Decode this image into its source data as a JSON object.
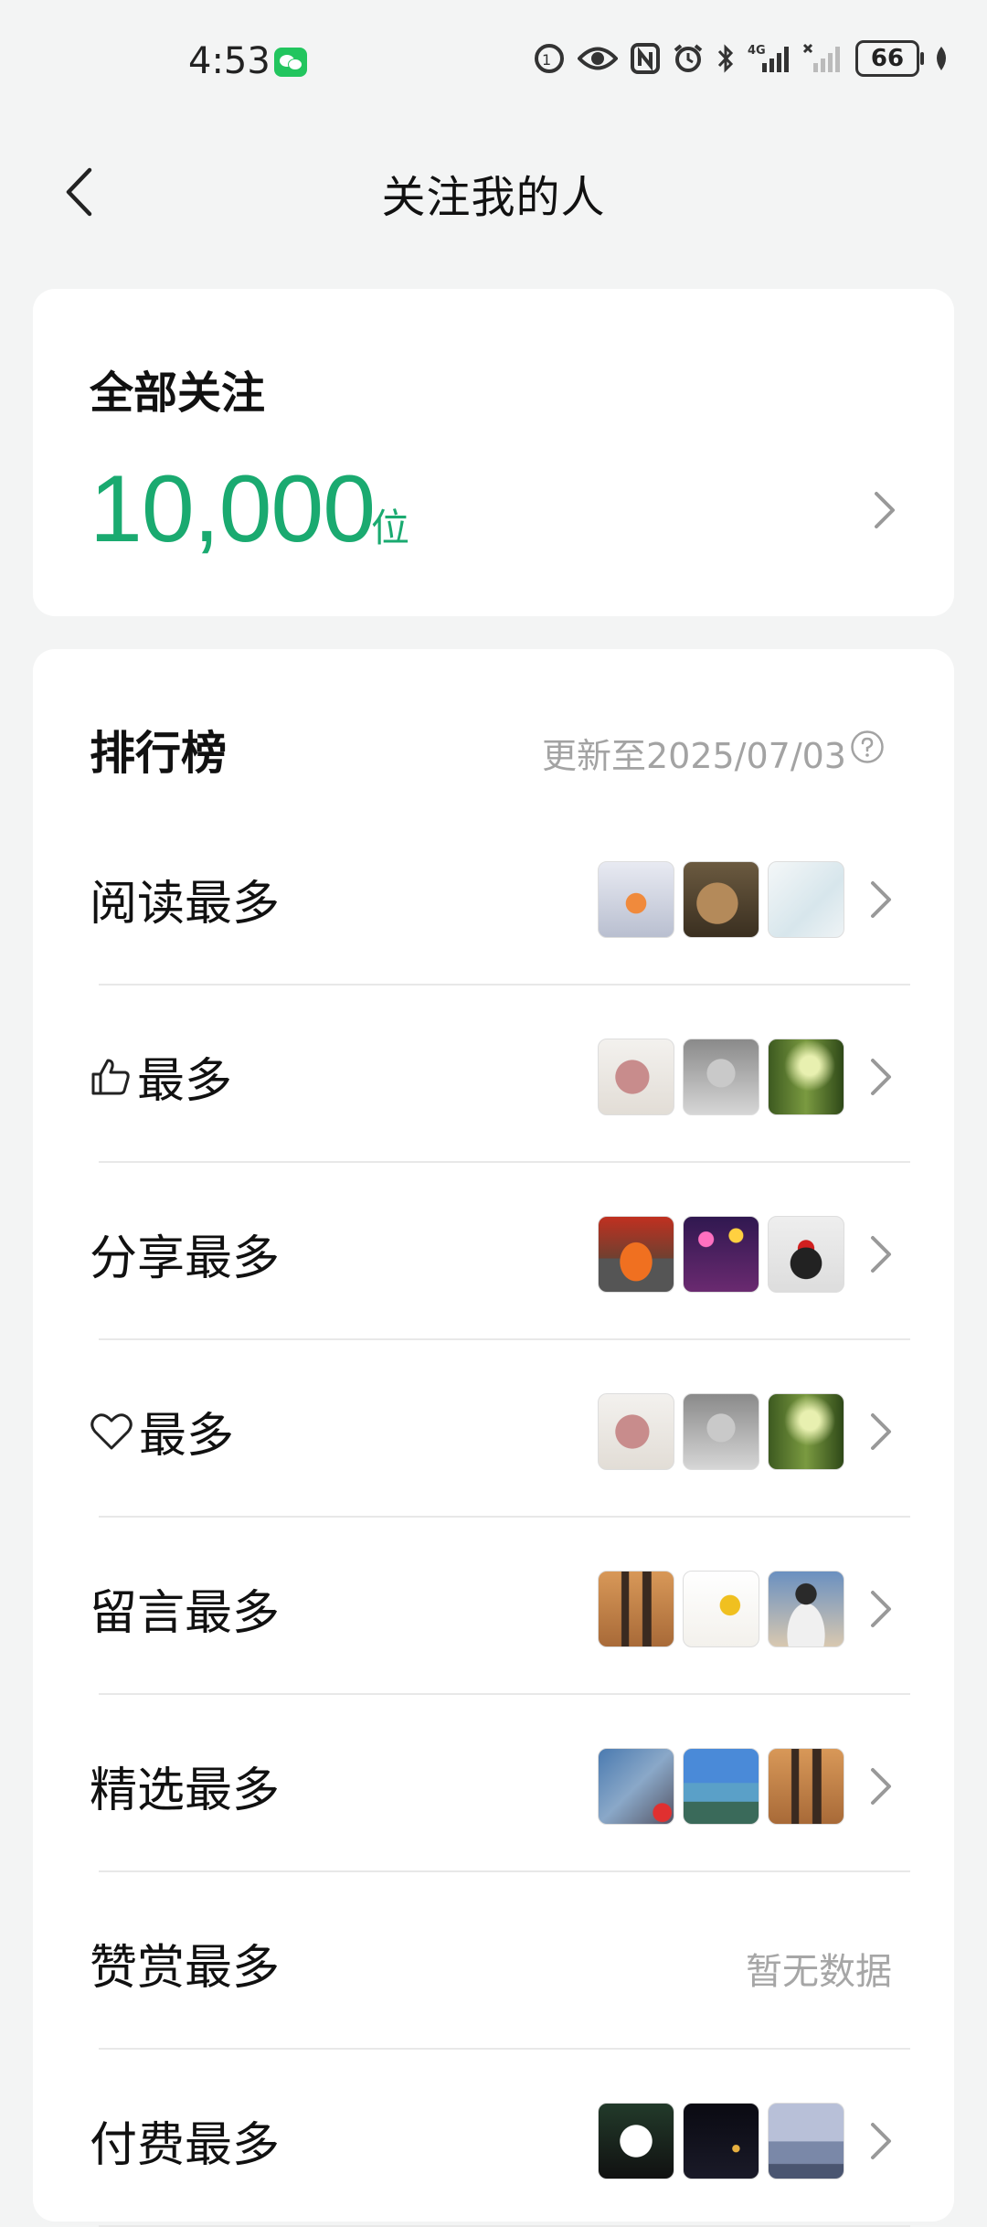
{
  "status_bar": {
    "time": "4:53",
    "battery": "66",
    "icons": [
      "wechat-notification-icon",
      "hd-voice-icon",
      "eye-icon",
      "nfc-icon",
      "alarm-icon",
      "bluetooth-icon",
      "signal-4g-icon",
      "signal-no-service-icon",
      "battery-icon",
      "leaf-icon"
    ]
  },
  "nav": {
    "title": "关注我的人",
    "back_icon": "chevron-left-icon"
  },
  "total": {
    "title": "全部关注",
    "value": "10,000",
    "unit": "位"
  },
  "ranking": {
    "title": "排行榜",
    "updated": "更新至2025/07/03",
    "rows": [
      {
        "label": "阅读最多",
        "icon": null,
        "thumbs": [
          "goldfish-thumb",
          "cat-thumb",
          "sketch-figure-thumb"
        ],
        "empty": null
      },
      {
        "label": "最多",
        "icon": "thumbs-up-icon",
        "thumbs": [
          "brain-diagram-thumb",
          "anime-sketch-thumb",
          "bamboo-forest-thumb"
        ],
        "empty": null
      },
      {
        "label": "分享最多",
        "icon": null,
        "thumbs": [
          "sports-car-thumb",
          "fireworks-girl-thumb",
          "penguin-power-thumb"
        ],
        "empty": null
      },
      {
        "label": "最多",
        "icon": "heart-icon",
        "thumbs": [
          "brain-diagram-thumb",
          "anime-sketch-thumb",
          "bamboo-forest-thumb"
        ],
        "empty": null
      },
      {
        "label": "留言最多",
        "icon": null,
        "thumbs": [
          "shadow-family-thumb",
          "sunflower-thumb",
          "man-in-cap-thumb"
        ],
        "empty": null
      },
      {
        "label": "精选最多",
        "icon": null,
        "thumbs": [
          "cliff-climber-thumb",
          "seaside-bay-thumb",
          "shadow-family-thumb"
        ],
        "empty": null
      },
      {
        "label": "赞赏最多",
        "icon": null,
        "thumbs": [],
        "empty": "暂无数据"
      },
      {
        "label": "付费最多",
        "icon": null,
        "thumbs": [
          "panda-thumb",
          "night-road-thumb",
          "sunset-sea-thumb"
        ],
        "empty": null
      }
    ]
  },
  "colors": {
    "accent": "#1aaa70",
    "background": "#f3f4f4",
    "card": "#ffffff",
    "muted_text": "#a3a3a3"
  }
}
